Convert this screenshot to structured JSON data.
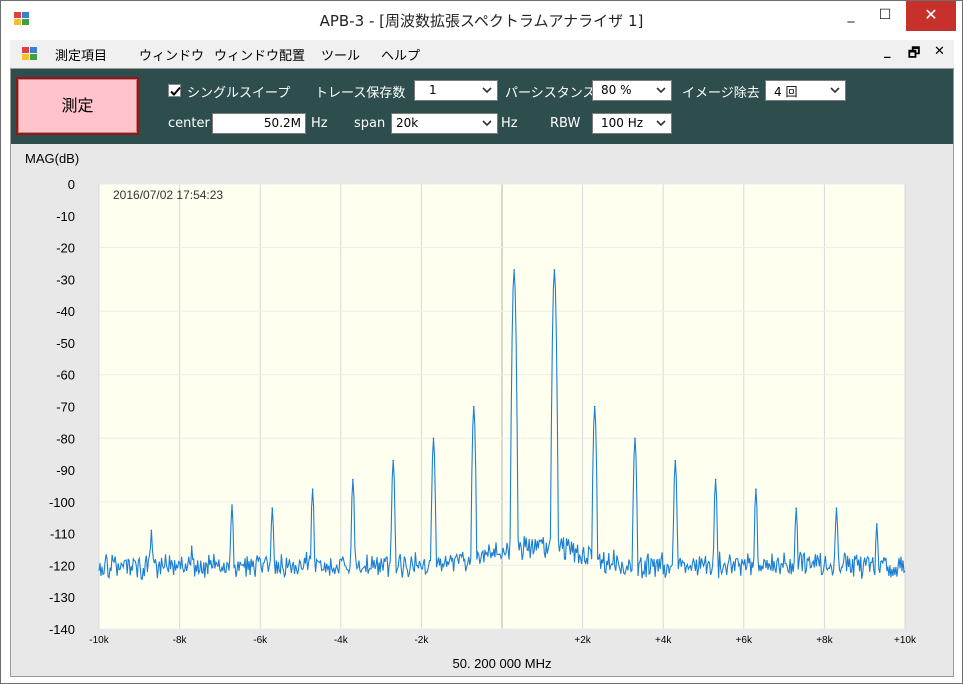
{
  "window": {
    "title": "APB-3 - [周波数拡張スペクトラムアナライザ 1]",
    "minimize_glyph": "_",
    "maximize_glyph": "☐",
    "close_glyph": "✕"
  },
  "menu": {
    "items": [
      "測定項目",
      "ウィンドウ",
      "ウィンドウ配置",
      "ツール",
      "ヘルプ"
    ],
    "mdi_minimize": "_",
    "mdi_restore": "🗗",
    "mdi_close": "✕"
  },
  "toolbar": {
    "measure_button": "測定",
    "single_sweep": {
      "label": "シングルスイープ",
      "checked": true
    },
    "trace_hold": {
      "label": "トレース保存数",
      "value": "1"
    },
    "persistence": {
      "label": "パーシスタンス",
      "value": "80 %"
    },
    "image_reject": {
      "label": "イメージ除去",
      "value": "4 回"
    },
    "center": {
      "label": "center",
      "value": "50.2M",
      "unit": "Hz"
    },
    "span": {
      "label": "span",
      "value": "20k",
      "unit": "Hz"
    },
    "rbw": {
      "label": "RBW",
      "value": "100 Hz"
    }
  },
  "colors": {
    "toolbar_bg": "#2e4e4e",
    "plot_bg": "#fffff0",
    "trace": "#1a7fd4",
    "measure_button_bg": "#ffc3cb"
  },
  "chart_data": {
    "type": "line",
    "ylabel": "MAG(dB)",
    "xlabel": "50. 200 000 MHz",
    "timestamp": "2016/07/02 17:54:23",
    "ylim": [
      -140,
      0
    ],
    "xlim": [
      -10000,
      10000
    ],
    "y_ticks": [
      "0",
      "-10",
      "-20",
      "-30",
      "-40",
      "-50",
      "-60",
      "-70",
      "-80",
      "-90",
      "-100",
      "-110",
      "-120",
      "-130",
      "-140"
    ],
    "x_ticks": [
      "-10k",
      "-8k",
      "-6k",
      "-4k",
      "-2k",
      "",
      "+2k",
      "+4k",
      "+6k",
      "+8k",
      "+10k"
    ],
    "grid": true,
    "noise_floor": -120,
    "peaks": [
      {
        "x": -8700,
        "y": -109
      },
      {
        "x": -7700,
        "y": -114
      },
      {
        "x": -6700,
        "y": -101
      },
      {
        "x": -5700,
        "y": -102
      },
      {
        "x": -4700,
        "y": -96
      },
      {
        "x": -3700,
        "y": -93
      },
      {
        "x": -2700,
        "y": -87
      },
      {
        "x": -1700,
        "y": -80
      },
      {
        "x": -700,
        "y": -70
      },
      {
        "x": 300,
        "y": -27
      },
      {
        "x": 1300,
        "y": -27
      },
      {
        "x": 2300,
        "y": -70
      },
      {
        "x": 3300,
        "y": -80
      },
      {
        "x": 4300,
        "y": -87
      },
      {
        "x": 5300,
        "y": -93
      },
      {
        "x": 6300,
        "y": -96
      },
      {
        "x": 7300,
        "y": -102
      },
      {
        "x": 8300,
        "y": -102
      },
      {
        "x": 9300,
        "y": -107
      }
    ]
  }
}
